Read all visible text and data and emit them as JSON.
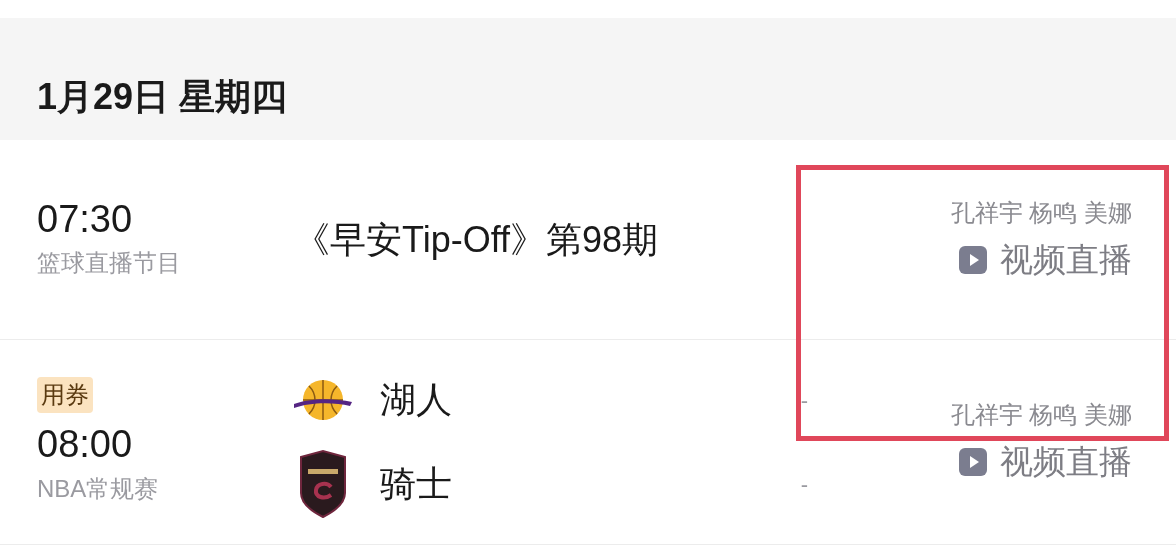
{
  "date_header": "1月29日 星期四",
  "annotation_frame": true,
  "programs": [
    {
      "kind": "show",
      "time": "07:30",
      "category": "篮球直播节目",
      "title": "《早安Tip-Off》第98期",
      "commentators": "孔祥宇 杨鸣 美娜",
      "live_label": "视频直播"
    },
    {
      "kind": "game",
      "badge": "用券",
      "time": "08:00",
      "category": "NBA常规赛",
      "teams": [
        {
          "name": "湖人",
          "score": "-",
          "kind": "ball"
        },
        {
          "name": "骑士",
          "score": "-",
          "kind": "shield"
        }
      ],
      "commentators": "孔祥宇 杨鸣 美娜",
      "live_label": "视频直播"
    }
  ]
}
